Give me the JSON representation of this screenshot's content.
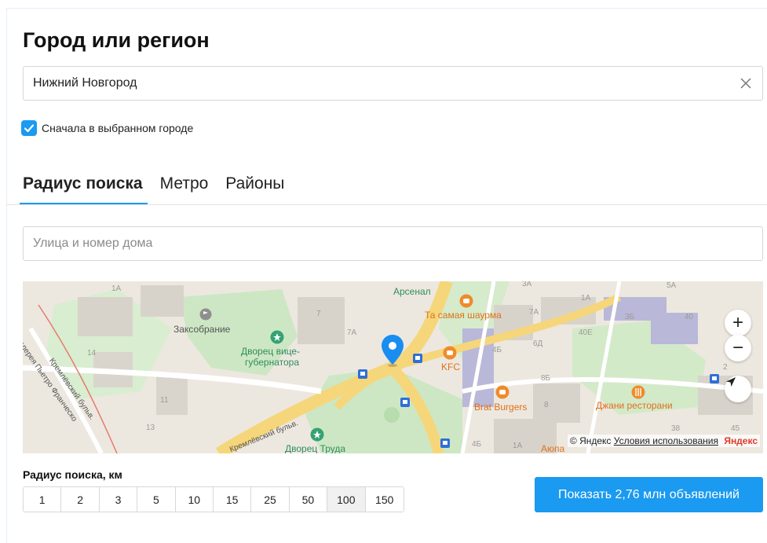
{
  "title": "Город или регион",
  "city": {
    "value": "Нижний Новгород"
  },
  "first_in_city": {
    "label": "Сначала в выбранном городе",
    "checked": true
  },
  "tabs": [
    {
      "label": "Радиус поиска",
      "active": true
    },
    {
      "label": "Метро",
      "active": false
    },
    {
      "label": "Районы",
      "active": false
    }
  ],
  "address": {
    "placeholder": "Улица и номер дома"
  },
  "map": {
    "labels": {
      "arsenal": "Арсенал",
      "shaurma": "Та самая шаурма",
      "zaksobranie": "Заксобрание",
      "dvorets_vice": "Дворец вице-",
      "gubernatora": "губернатора",
      "kfc": "KFC",
      "brat_burgers": "Brat Burgers",
      "dzhani": "Джани ресторани",
      "dvorets_truda": "Дворец Труда",
      "galereya": "Галерея Пьетро Франческо",
      "kremlevsky": "Кремлёвский бульв.",
      "kremlevsky2": "Кремлёвский бульв.",
      "aiopa": "Аюпа"
    },
    "house_numbers": [
      "1А",
      "14",
      "11",
      "13",
      "7",
      "7А",
      "3А",
      "7А",
      "1А",
      "3Б",
      "40",
      "40Е",
      "6Д",
      "4Б",
      "8Б",
      "8",
      "5А",
      "38",
      "45",
      "2",
      "4Б",
      "1А"
    ],
    "copyright": "© Яндекс",
    "terms": "Условия использования",
    "brand": "Яндекс",
    "zoom_in": "+",
    "zoom_out": "−"
  },
  "radius": {
    "label": "Радиус поиска, км",
    "options": [
      "1",
      "2",
      "3",
      "5",
      "10",
      "15",
      "25",
      "50",
      "100",
      "150"
    ],
    "selected": "100"
  },
  "show_button": "Показать 2,76 млн объявлений",
  "colors": {
    "accent": "#1a9af0",
    "brand": "#e03b2c"
  }
}
